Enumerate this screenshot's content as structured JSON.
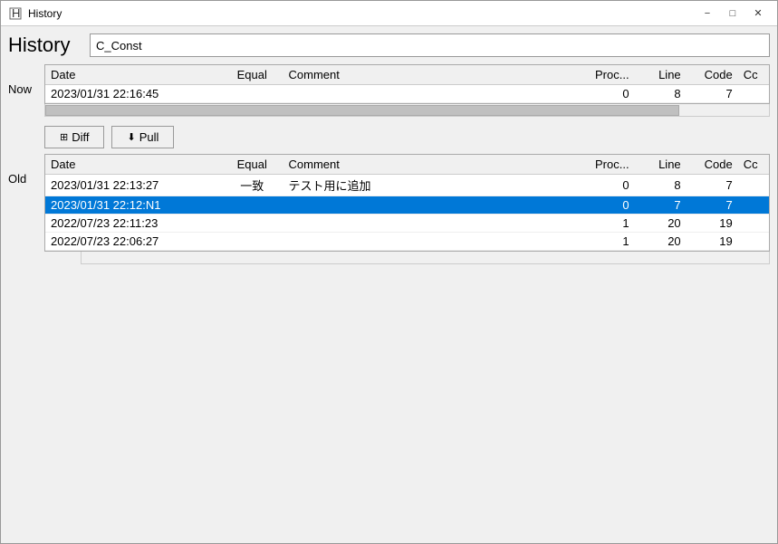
{
  "titleBar": {
    "icon": "H",
    "title": "History",
    "minimizeLabel": "−",
    "maximizeLabel": "□",
    "closeLabel": "✕"
  },
  "pageTitle": "History",
  "searchInput": {
    "value": "C_Const",
    "placeholder": ""
  },
  "sectionNow": {
    "label": "Now",
    "columns": [
      "Date",
      "Equal",
      "Comment",
      "Proc...",
      "Line",
      "Code",
      "Cc"
    ],
    "rows": [
      {
        "date": "2023/01/31 22:16:45",
        "equal": "",
        "comment": "",
        "proc": "0",
        "line": "8",
        "code": "7",
        "cc": ""
      }
    ]
  },
  "buttons": {
    "diff": "Diff",
    "pull": "Pull"
  },
  "sectionOld": {
    "label": "Old",
    "columns": [
      "Date",
      "Equal",
      "Comment",
      "Proc...",
      "Line",
      "Code",
      "Cc"
    ],
    "rows": [
      {
        "date": "2023/01/31 22:13:27",
        "equal": "一致",
        "comment": "テスト用に追加",
        "proc": "0",
        "line": "8",
        "code": "7",
        "cc": "",
        "selected": false
      },
      {
        "date": "2023/01/31 22:12:N1",
        "equal": "",
        "comment": "",
        "proc": "0",
        "line": "7",
        "code": "7",
        "cc": "",
        "selected": true
      },
      {
        "date": "2022/07/23 22:11:23",
        "equal": "",
        "comment": "",
        "proc": "1",
        "line": "20",
        "code": "19",
        "cc": "",
        "selected": false
      },
      {
        "date": "2022/07/23 22:06:27",
        "equal": "",
        "comment": "",
        "proc": "1",
        "line": "20",
        "code": "19",
        "cc": "",
        "selected": false
      }
    ]
  }
}
